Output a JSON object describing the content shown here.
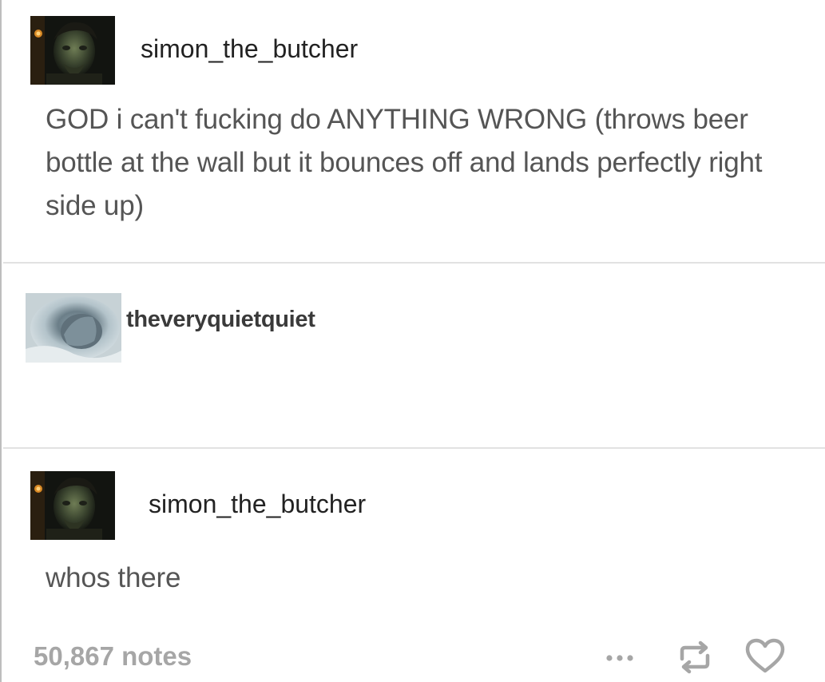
{
  "posts": [
    {
      "username": "simon_the_butcher",
      "text": "GOD i can't fucking do ANYTHING WRONG (throws beer bottle at the wall but it bounces off and lands perfectly right side up)"
    },
    {
      "username": "theveryquietquiet",
      "text": ""
    },
    {
      "username": "simon_the_butcher",
      "text": "whos there"
    }
  ],
  "footer": {
    "notes": "50,867 notes",
    "actions": [
      "more-icon",
      "reblog-icon",
      "like-icon"
    ]
  },
  "colors": {
    "text": "#555555",
    "notes": "#a6a6a6",
    "divider": "#e2e2e2"
  }
}
